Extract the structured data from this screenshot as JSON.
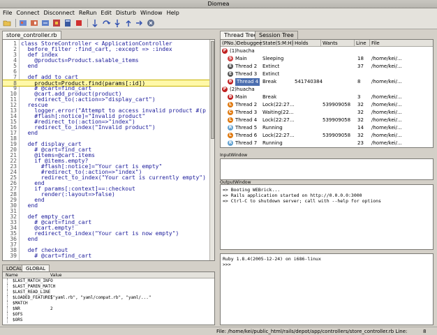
{
  "window": {
    "title": "Diomea"
  },
  "menu": [
    "File",
    "Connect",
    "Disconnect",
    "ReRun",
    "Edit",
    "Disturb",
    "Window",
    "Help"
  ],
  "toolbar_icons": [
    "open-folder-icon",
    "debug-icon",
    "run-icon",
    "settings-icon",
    "bug-icon",
    "book-icon",
    "stop-icon",
    "step-icon",
    "step-over-icon",
    "step-into-icon",
    "step-out-icon",
    "forward-icon",
    "close-circle-icon"
  ],
  "editor": {
    "tab": "store_controller.rb",
    "highlight_line": 8,
    "lines": [
      {
        "n": "1",
        "t": "class StoreController < ApplicationController"
      },
      {
        "n": "2",
        "t": "  before_filter :find_cart, :except => :index"
      },
      {
        "n": "3",
        "t": "  def index"
      },
      {
        "n": "4",
        "t": "    @products=Product.salable_items"
      },
      {
        "n": "5",
        "t": "  end"
      },
      {
        "n": "6",
        "t": ""
      },
      {
        "n": "7",
        "t": "  def add_to_cart"
      },
      {
        "n": "8",
        "t": "    product=Product.find(params[:id])"
      },
      {
        "n": "9",
        "t": "    # @cart=find_cart"
      },
      {
        "n": "10",
        "t": "    @cart.add_product(product)"
      },
      {
        "n": "11",
        "t": "    redirect_to(:action=>\"display_cart\")"
      },
      {
        "n": "12",
        "t": "  rescue"
      },
      {
        "n": "13",
        "t": "    logger.error(\"Attempt to access invalid product #(p"
      },
      {
        "n": "14",
        "t": "    #flash[:notice]=\"Invalid product\""
      },
      {
        "n": "15",
        "t": "    #redirect_to(:action=>\"index\")"
      },
      {
        "n": "16",
        "t": "    redirect_to_index(\"Invalid product\")"
      },
      {
        "n": "17",
        "t": "  end"
      },
      {
        "n": "18",
        "t": ""
      },
      {
        "n": "19",
        "t": "  def display_cart"
      },
      {
        "n": "20",
        "t": "    # @cart=find_cart"
      },
      {
        "n": "21",
        "t": "    @items=@cart.items"
      },
      {
        "n": "22",
        "t": "    if @items.empty?"
      },
      {
        "n": "23",
        "t": "      #flash[:notice]=\"Your cart is empty\""
      },
      {
        "n": "24",
        "t": "      #redirect_to(:action=>\"index\")"
      },
      {
        "n": "25",
        "t": "      redirect_to_index(\"Your cart is currently empty\")"
      },
      {
        "n": "26",
        "t": "    end"
      },
      {
        "n": "27",
        "t": "    if params[:context]==:checkout"
      },
      {
        "n": "28",
        "t": "      render(:layout=>false)"
      },
      {
        "n": "29",
        "t": "    end"
      },
      {
        "n": "30",
        "t": "  end"
      },
      {
        "n": "31",
        "t": ""
      },
      {
        "n": "32",
        "t": "  def empty_cart"
      },
      {
        "n": "33",
        "t": "    # @cart=find_cart"
      },
      {
        "n": "34",
        "t": "    @cart.empty!"
      },
      {
        "n": "35",
        "t": "    redirect_to_index(\"Your cart is now empty\")"
      },
      {
        "n": "36",
        "t": "  end"
      },
      {
        "n": "37",
        "t": ""
      },
      {
        "n": "38",
        "t": "  def checkout"
      },
      {
        "n": "39",
        "t": "    # @cart=find_cart"
      }
    ]
  },
  "variables": {
    "tabs": [
      "LOCAL",
      "GLOBAL"
    ],
    "headers": [
      "Name",
      "Value"
    ],
    "rows": [
      {
        "name": "$LAST_MATCH_INFO",
        "value": ""
      },
      {
        "name": "$LAST_PAREN_MATCH",
        "value": ""
      },
      {
        "name": "$LAST_READ_LINE",
        "value": ""
      },
      {
        "name": "$LOADED_FEATURES",
        "value": "[\"yaml.rb\", \"yaml/compat.rb\", \"yaml/...\""
      },
      {
        "name": "$MATCH",
        "value": ""
      },
      {
        "name": "$NR",
        "value": "2"
      },
      {
        "name": "$OFS",
        "value": ""
      },
      {
        "name": "$ORS",
        "value": ""
      }
    ]
  },
  "threads": {
    "tabs": [
      "Thread Tree",
      "Session Tree"
    ],
    "headers": [
      "(PNo.)Debuggee",
      "State(S:M:H)",
      "Holds",
      "Wants",
      "Line",
      "File"
    ],
    "rows": [
      {
        "indent": 0,
        "badge": "P",
        "color": "#c02020",
        "name": "(1)huacha",
        "state": "",
        "holds": "",
        "wants": "",
        "line": "",
        "file": "",
        "selected": false
      },
      {
        "indent": 1,
        "badge": "S",
        "color": "#d04040",
        "name": "Main",
        "state": "Sleeping",
        "holds": "",
        "wants": "",
        "line": "18",
        "file": "/home/kei/...",
        "selected": false
      },
      {
        "indent": 1,
        "badge": "E",
        "color": "#555555",
        "name": "Thread 2",
        "state": "Extinct",
        "holds": "",
        "wants": "",
        "line": "37",
        "file": "/home/kei/...",
        "selected": false
      },
      {
        "indent": 1,
        "badge": "E",
        "color": "#555555",
        "name": "Thread 3",
        "state": "Extinct",
        "holds": "",
        "wants": "",
        "line": "",
        "file": "",
        "selected": false
      },
      {
        "indent": 1,
        "badge": "B",
        "color": "#c02020",
        "name": "Thread 4",
        "state": "Break",
        "holds": "541740384",
        "wants": "",
        "line": "8",
        "file": "/home/kei/...",
        "selected": true
      },
      {
        "indent": 0,
        "badge": "P",
        "color": "#c02020",
        "name": "(2)huacha",
        "state": "",
        "holds": "",
        "wants": "",
        "line": "",
        "file": "",
        "selected": false
      },
      {
        "indent": 1,
        "badge": "B",
        "color": "#c02020",
        "name": "Main",
        "state": "Break",
        "holds": "",
        "wants": "",
        "line": "3",
        "file": "/home/kei/...",
        "selected": false
      },
      {
        "indent": 1,
        "badge": "L",
        "color": "#e07a10",
        "name": "Thread 2",
        "state": "Lock(22:27...",
        "holds": "",
        "wants": "539909058",
        "line": "32",
        "file": "/home/kei/...",
        "selected": false
      },
      {
        "indent": 1,
        "badge": "C",
        "color": "#e07a10",
        "name": "Thread 3",
        "state": "Waiting(22...",
        "holds": "",
        "wants": "",
        "line": "32",
        "file": "/home/kei/...",
        "selected": false
      },
      {
        "indent": 1,
        "badge": "L",
        "color": "#e07a10",
        "name": "Thread 4",
        "state": "Lock(22:27...",
        "holds": "",
        "wants": "539909058",
        "line": "32",
        "file": "/home/kei/...",
        "selected": false
      },
      {
        "indent": 1,
        "badge": "R",
        "color": "#5fa0d0",
        "name": "Thread 5",
        "state": "Running",
        "holds": "",
        "wants": "",
        "line": "14",
        "file": "/home/kei/...",
        "selected": false
      },
      {
        "indent": 1,
        "badge": "L",
        "color": "#e07a10",
        "name": "Thread 6",
        "state": "Lock(22:27...",
        "holds": "",
        "wants": "539909058",
        "line": "32",
        "file": "/home/kei/...",
        "selected": false
      },
      {
        "indent": 1,
        "badge": "R",
        "color": "#5fa0d0",
        "name": "Thread 7",
        "state": "Running",
        "holds": "",
        "wants": "",
        "line": "23",
        "file": "/home/kei/...",
        "selected": false
      }
    ]
  },
  "input_window": {
    "label": "InputWindow"
  },
  "output_window": {
    "label": "OutputWindow",
    "lines": [
      "=> Booting WEBrick...",
      "=> Rails application started on http://0.0.0.0:3000",
      "=> Ctrl-C to shutdown server; call with --help for options"
    ]
  },
  "console": {
    "lines": [
      "Ruby 1.8.4(2005-12-24) on i686-linux",
      ">>>"
    ]
  },
  "status": {
    "text": "File: /home/kei/public_html/rails/depot/app/controllers/store_controller.rb   Line:",
    "line": "8"
  }
}
